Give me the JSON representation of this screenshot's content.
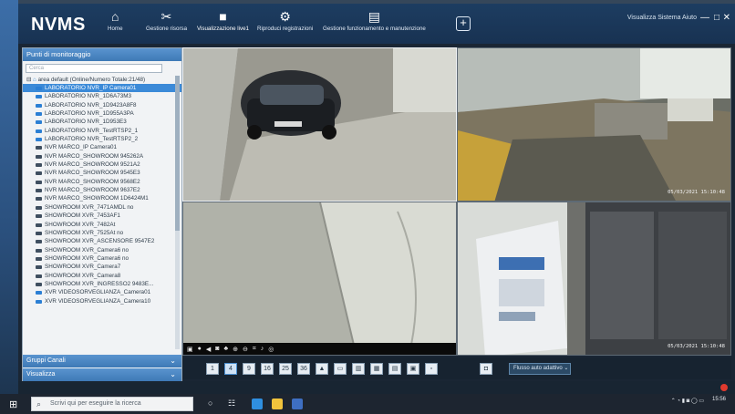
{
  "app": {
    "logo": "NVMS",
    "nav": [
      {
        "label": "Home",
        "icon": "home-icon"
      },
      {
        "label": "Gestione risorsa",
        "icon": "tools-icon"
      },
      {
        "label": "Visualizzazione live1",
        "icon": "video-camera-icon"
      },
      {
        "label": "Riproduci registrazioni",
        "icon": "playback-icon"
      },
      {
        "label": "Gestione funzionamento e manutenzione",
        "icon": "maintenance-icon"
      }
    ],
    "add_label": "+",
    "system_info": "Visualizza Sistema Aiuto",
    "window_buttons": {
      "minimize": "—",
      "maximize": "□",
      "close": "✕"
    }
  },
  "sidebar": {
    "header": "Punti di monitoraggio",
    "search_placeholder": "Cerca",
    "root": "area default (Online/Numero Totale:21/48)",
    "items": [
      {
        "label": "LABORATORIO NVR_IP Camera01",
        "selected": true,
        "blue": true
      },
      {
        "label": "LABORATORIO NVR_1D6A73M3",
        "blue": true
      },
      {
        "label": "LABORATORIO NVR_1D9423A8F8",
        "blue": true
      },
      {
        "label": "LABORATORIO NVR_1D955A3PA",
        "blue": true
      },
      {
        "label": "LABORATORIO NVR_1D953E3",
        "blue": true
      },
      {
        "label": "LABORATORIO NVR_TestRTSP2_1",
        "blue": true
      },
      {
        "label": "LABORATORIO NVR_TestRTSP2_2",
        "blue": true
      },
      {
        "label": "NVR MARCO_IP Camera01"
      },
      {
        "label": "NVR MARCO_SHOWROOM 945262A"
      },
      {
        "label": "NVR MARCO_SHOWROOM 9521A2"
      },
      {
        "label": "NVR MARCO_SHOWROOM 9545E3"
      },
      {
        "label": "NVR MARCO_SHOWROOM 9568E2"
      },
      {
        "label": "NVR MARCO_SHOWROOM 9637E2"
      },
      {
        "label": "NVR MARCO_SHOWROOM 1D6424M1"
      },
      {
        "label": "SHOWROOM XVR_7471AMDL no"
      },
      {
        "label": "SHOWROOM XVR_7453AF1"
      },
      {
        "label": "SHOWROOM XVR_7482At"
      },
      {
        "label": "SHOWROOM XVR_7525At no"
      },
      {
        "label": "SHOWROOM XVR_ASCENSORE 9547E2"
      },
      {
        "label": "SHOWROOM XVR_Camera6 no"
      },
      {
        "label": "SHOWROOM XVR_Camera6 no"
      },
      {
        "label": "SHOWROOM XVR_Camera7"
      },
      {
        "label": "SHOWROOM XVR_Camera8"
      },
      {
        "label": "SHOWROOM XVR_INGRESSO2 9483E..."
      },
      {
        "label": "XVR VIDEOSORVEGLIANZA_Camera01",
        "blue": true
      },
      {
        "label": "XVR VIDEOSORVEGLIANZA_Camera10",
        "blue": true
      }
    ],
    "groups_label": "Gruppi Canali",
    "view_label": "Visualizza"
  },
  "grid": {
    "timestamps": [
      "05/03/2021 15:10:48",
      "05/03/2021 15:10:48"
    ]
  },
  "toolbar": {
    "layouts": [
      "1",
      "4",
      "9",
      "16",
      "25",
      "36"
    ],
    "select_value": "Flusso auto adattivo"
  },
  "taskbar": {
    "search_placeholder": "Scrivi qui per eseguire la ricerca",
    "time": "15:56"
  }
}
